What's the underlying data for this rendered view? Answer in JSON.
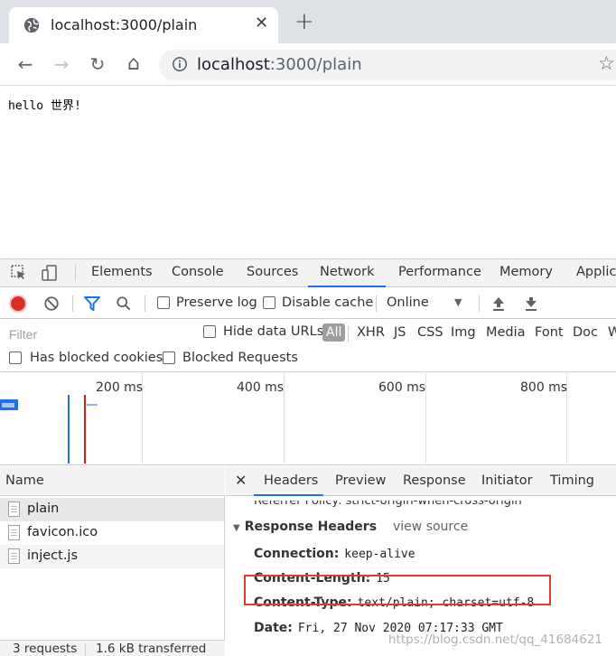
{
  "tab": {
    "title": "localhost:3000/plain",
    "close_glyph": "✕",
    "newtab_glyph": "+"
  },
  "toolbar": {
    "back_glyph": "←",
    "forward_glyph": "→",
    "reload_glyph": "↻",
    "home_glyph": "⌂",
    "url_host": "localhost",
    "url_path": ":3000/plain",
    "star_glyph": "☆"
  },
  "page": {
    "body_text": "hello 世界!"
  },
  "devtools": {
    "tabs": [
      "Elements",
      "Console",
      "Sources",
      "Network",
      "Performance",
      "Memory",
      "Applica"
    ],
    "active_tab": "Network",
    "network_toolbar": {
      "preserve_log": "Preserve log",
      "disable_cache": "Disable cache",
      "throttle": "Online"
    },
    "filter": {
      "placeholder": "Filter",
      "hide_data_urls": "Hide data URLs",
      "types": [
        "All",
        "XHR",
        "JS",
        "CSS",
        "Img",
        "Media",
        "Font",
        "Doc",
        "W"
      ],
      "has_blocked_cookies": "Has blocked cookies",
      "blocked_requests": "Blocked Requests"
    },
    "timeline": {
      "ticks": [
        "200 ms",
        "400 ms",
        "600 ms",
        "800 ms"
      ]
    },
    "requests": {
      "column": "Name",
      "items": [
        "plain",
        "favicon.ico",
        "inject.js"
      ],
      "summary_count": "3 requests",
      "summary_transfer": "1.6 kB transferred"
    },
    "details": {
      "tabs": [
        "Headers",
        "Preview",
        "Response",
        "Initiator",
        "Timing"
      ],
      "active_tab": "Headers",
      "cut_row": "Referrer Policy: strict-origin-when-cross-origin",
      "section_title": "Response Headers",
      "view_source": "view source",
      "headers": [
        {
          "key": "Connection:",
          "value": "keep-alive"
        },
        {
          "key": "Content-Length:",
          "value": "15"
        },
        {
          "key": "Content-Type:",
          "value": "text/plain; charset=utf-8"
        },
        {
          "key": "Date:",
          "value": "Fri, 27 Nov 2020 07:17:33 GMT"
        }
      ]
    },
    "watermark": "https://blog.csdn.net/qq_41684621"
  },
  "colors": {
    "record": "#d93025",
    "accent": "#1a73e8",
    "highlight_box": "#e53935"
  }
}
